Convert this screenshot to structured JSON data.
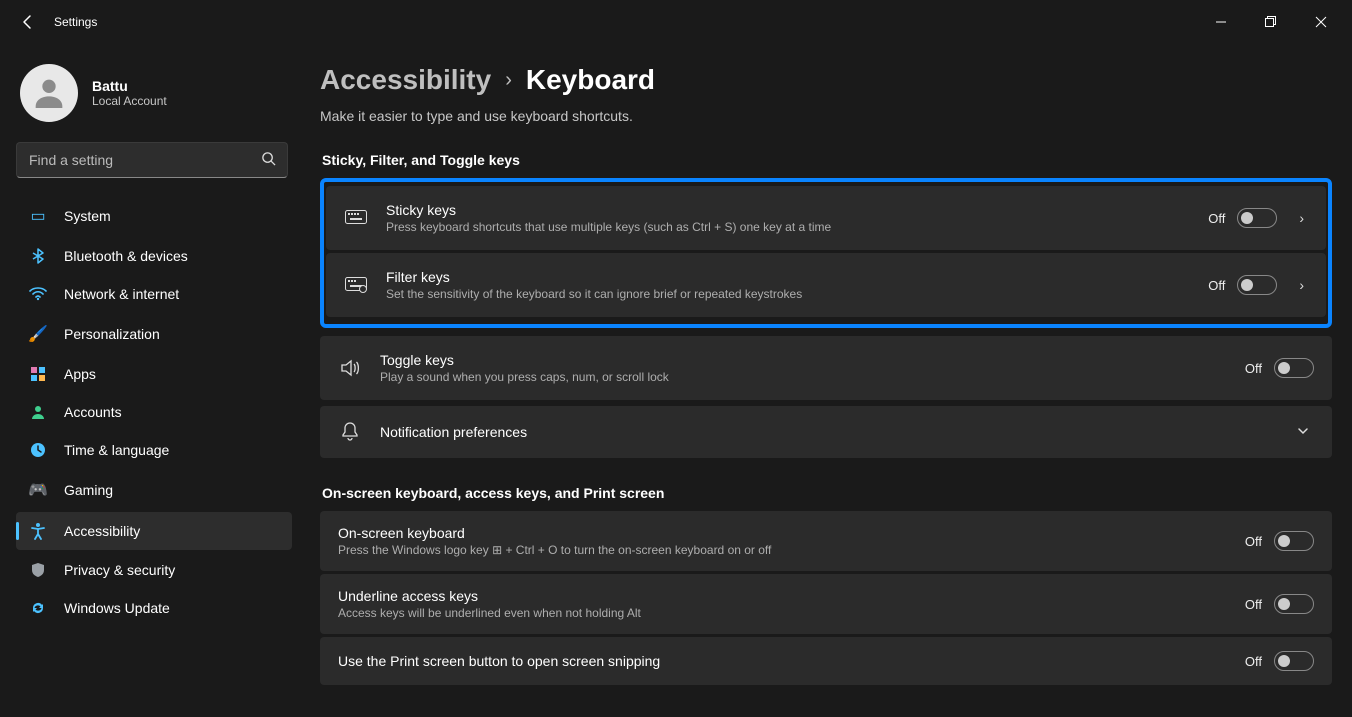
{
  "app": {
    "title": "Settings"
  },
  "user": {
    "name": "Battu",
    "account_type": "Local Account"
  },
  "search": {
    "placeholder": "Find a setting"
  },
  "nav": {
    "items": [
      {
        "label": "System",
        "icon": "🖥️"
      },
      {
        "label": "Bluetooth & devices",
        "icon": "bt"
      },
      {
        "label": "Network & internet",
        "icon": "wifi"
      },
      {
        "label": "Personalization",
        "icon": "🖌️"
      },
      {
        "label": "Apps",
        "icon": "▦"
      },
      {
        "label": "Accounts",
        "icon": "👤"
      },
      {
        "label": "Time & language",
        "icon": "🕒"
      },
      {
        "label": "Gaming",
        "icon": "🎮"
      },
      {
        "label": "Accessibility",
        "icon": "acc"
      },
      {
        "label": "Privacy & security",
        "icon": "🛡️"
      },
      {
        "label": "Windows Update",
        "icon": "🔄"
      }
    ]
  },
  "breadcrumb": {
    "parent": "Accessibility",
    "current": "Keyboard"
  },
  "page": {
    "subtitle": "Make it easier to type and use keyboard shortcuts."
  },
  "sections": {
    "sticky_filter_toggle": {
      "title": "Sticky, Filter, and Toggle keys"
    },
    "onscreen": {
      "title": "On-screen keyboard, access keys, and Print screen"
    }
  },
  "cards": {
    "sticky": {
      "title": "Sticky keys",
      "desc": "Press keyboard shortcuts that use multiple keys (such as Ctrl + S) one key at a time",
      "state": "Off"
    },
    "filter": {
      "title": "Filter keys",
      "desc": "Set the sensitivity of the keyboard so it can ignore brief or repeated keystrokes",
      "state": "Off"
    },
    "togglekeys": {
      "title": "Toggle keys",
      "desc": "Play a sound when you press caps, num, or scroll lock",
      "state": "Off"
    },
    "notif": {
      "title": "Notification preferences"
    },
    "osk": {
      "title": "On-screen keyboard",
      "desc": "Press the Windows logo key ⊞ + Ctrl + O to turn the on-screen keyboard on or off",
      "state": "Off"
    },
    "underline": {
      "title": "Underline access keys",
      "desc": "Access keys will be underlined even when not holding Alt",
      "state": "Off"
    },
    "prtsc": {
      "title": "Use the Print screen button to open screen snipping",
      "state": "Off"
    }
  }
}
